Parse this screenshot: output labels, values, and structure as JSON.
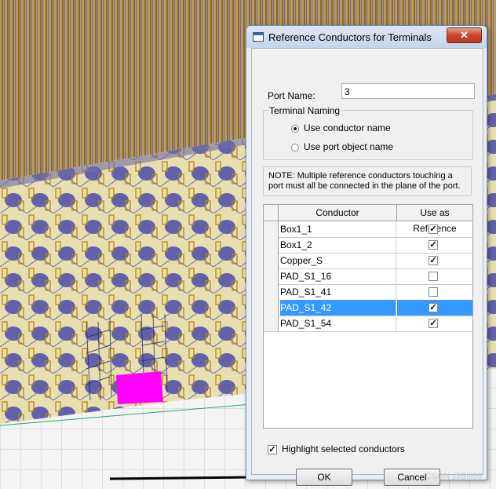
{
  "dialog": {
    "title": "Reference Conductors for Terminals",
    "close_glyph": "✕",
    "port_name_label": "Port Name:",
    "port_name_value": "3",
    "terminal_naming": {
      "legend": "Terminal Naming",
      "options": [
        {
          "label": "Use conductor name",
          "selected": true
        },
        {
          "label": "Use port object name",
          "selected": false
        }
      ]
    },
    "note": "NOTE: Multiple reference conductors touching a port must all be connected in the plane of the port.",
    "table": {
      "columns": [
        "Conductor",
        "Use as Reference"
      ],
      "rows": [
        {
          "conductor": "Box1_1",
          "use_as_reference": true
        },
        {
          "conductor": "Box1_2",
          "use_as_reference": true
        },
        {
          "conductor": "Copper_S",
          "use_as_reference": true
        },
        {
          "conductor": "PAD_S1_16",
          "use_as_reference": false
        },
        {
          "conductor": "PAD_S1_41",
          "use_as_reference": false
        },
        {
          "conductor": "PAD_S1_42",
          "use_as_reference": true,
          "selected": true
        },
        {
          "conductor": "PAD_S1_54",
          "use_as_reference": true
        }
      ]
    },
    "highlight_label": "Highlight selected conductors",
    "highlight_checked": true,
    "ok_label": "OK",
    "cancel_label": "Cancel"
  },
  "check_glyph": "✓",
  "watermark": "CSDN @Bill66",
  "colors": {
    "selection": "#3399ff",
    "highlight_port": "#ff00ff",
    "model_body": "#e8dfb0",
    "model_outline": "#b8860b",
    "model_dots": "#3a3aa8"
  }
}
